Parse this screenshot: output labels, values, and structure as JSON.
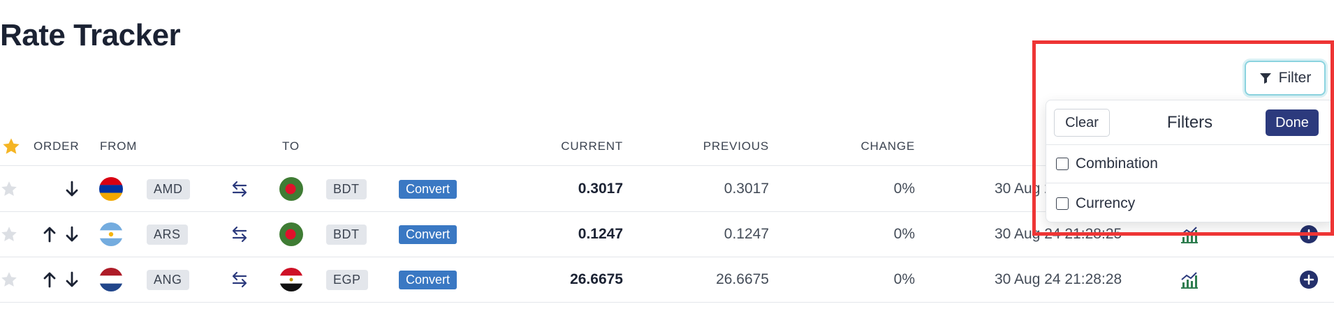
{
  "page": {
    "title": "Rate Tracker"
  },
  "table": {
    "headers": {
      "order": "ORDER",
      "from": "FROM",
      "to": "TO",
      "current": "CURRENT",
      "previous": "PREVIOUS",
      "change": "CHANGE"
    },
    "convert_label": "Convert",
    "rows": [
      {
        "from": "AMD",
        "to": "BDT",
        "current": "0.3017",
        "previous": "0.3017",
        "change": "0%",
        "updated": "30 Aug 24 21:28:25"
      },
      {
        "from": "ARS",
        "to": "BDT",
        "current": "0.1247",
        "previous": "0.1247",
        "change": "0%",
        "updated": "30 Aug 24 21:28:25"
      },
      {
        "from": "ANG",
        "to": "EGP",
        "current": "26.6675",
        "previous": "26.6675",
        "change": "0%",
        "updated": "30 Aug 24 21:28:28"
      }
    ]
  },
  "filter": {
    "button_label": "Filter",
    "panel": {
      "clear_label": "Clear",
      "title": "Filters",
      "done_label": "Done",
      "options": [
        "Combination",
        "Currency"
      ]
    }
  },
  "colors": {
    "accent": "#3a78c3",
    "done": "#2c3a7d",
    "highlight": "#ee3535",
    "star_active": "#f5b524"
  },
  "icons": {
    "favorite": "star-icon",
    "order_up": "arrow-up-icon",
    "order_down": "arrow-down-icon",
    "swap": "swap-arrows-icon",
    "chart": "trend-chart-icon",
    "add": "plus-circle-icon",
    "filter": "funnel-icon"
  }
}
